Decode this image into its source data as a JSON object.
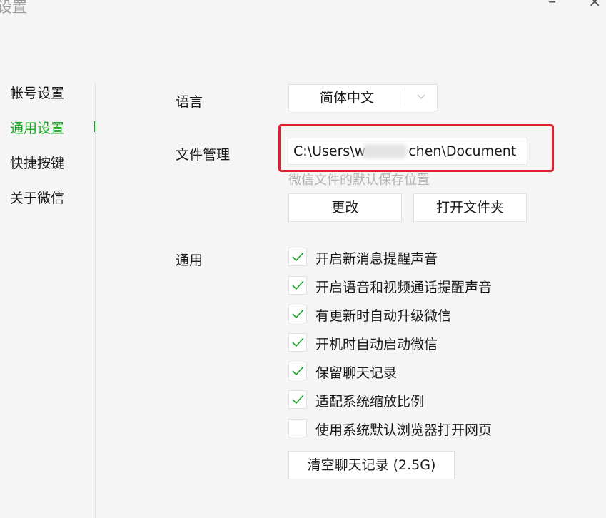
{
  "window": {
    "title": "设置",
    "minimize_label": "–",
    "close_label": "×"
  },
  "sidebar": {
    "items": [
      {
        "label": "帐号设置"
      },
      {
        "label": "通用设置"
      },
      {
        "label": "快捷按键"
      },
      {
        "label": "关于微信"
      }
    ]
  },
  "general": {
    "language": {
      "label": "语言",
      "selected": "简体中文",
      "icon": "chevron-down-icon"
    },
    "file_management": {
      "label": "文件管理",
      "path_before": "C:\\Users\\w",
      "path_after": "chen\\Document",
      "hint": "微信文件的默认保存位置",
      "change_label": "更改",
      "open_folder_label": "打开文件夹"
    },
    "options": {
      "label": "通用",
      "items": [
        {
          "label": "开启新消息提醒声音",
          "checked": true
        },
        {
          "label": "开启语音和视频通话提醒声音",
          "checked": true
        },
        {
          "label": "有更新时自动升级微信",
          "checked": true
        },
        {
          "label": "开机时自动启动微信",
          "checked": true
        },
        {
          "label": "保留聊天记录",
          "checked": true
        },
        {
          "label": "适配系统缩放比例",
          "checked": true
        },
        {
          "label": "使用系统默认浏览器打开网页",
          "checked": false
        }
      ]
    },
    "clear_history_label": "清空聊天记录 (2.5G)"
  },
  "colors": {
    "accent": "#19a823",
    "highlight": "#e0202c",
    "hint": "#b3b3b3"
  }
}
